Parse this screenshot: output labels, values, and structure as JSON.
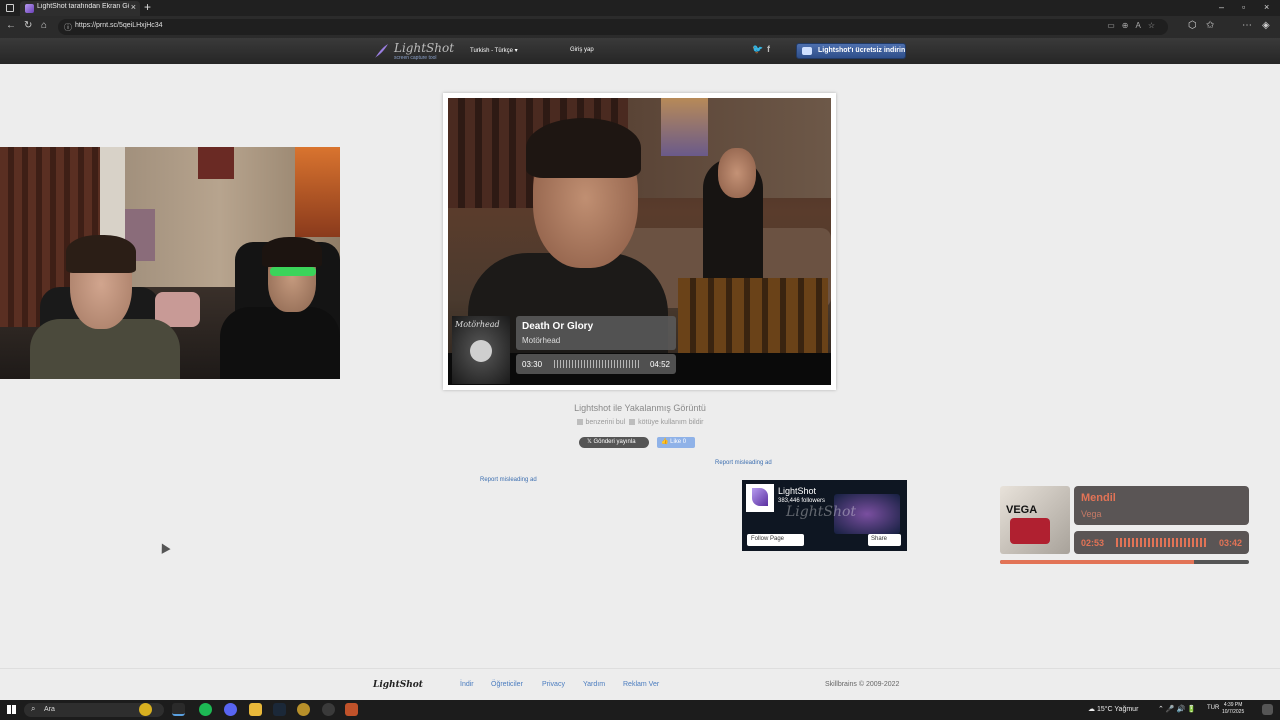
{
  "browser": {
    "tab_title": "LightShot tarafından Ekran Görün",
    "tab_close": "×",
    "new_tab": "+",
    "url": "https://prnt.sc/5qeiLHxjHc34",
    "window_controls": [
      "–",
      "▫",
      "×"
    ]
  },
  "site": {
    "logo_name": "LightShot",
    "logo_tagline": "screen capture tool",
    "language": "Turkish - Türkçe ▾",
    "login": "Giriş yap",
    "download_button": "Lightshot'ı ücretsiz indirin",
    "social": [
      "twitter-icon",
      "facebook-icon"
    ],
    "caption": "Lightshot ile Yakalanmış Görüntü",
    "similar_link": "benzerini bul",
    "report_abuse_link": "kötüye kullanım bildir",
    "tweet_button": "𝕏 Gönderi yayınla",
    "like_button": "👍 Like 0",
    "report_ad_1": "Report misleading ad",
    "report_ad_2": "Report misleading ad"
  },
  "screenshot_now_playing": {
    "album_label": "Motörhead",
    "title": "Death Or Glory",
    "artist": "Motörhead",
    "elapsed": "03:30",
    "duration": "04:52"
  },
  "fb_widget": {
    "page_name": "LightShot",
    "followers": "383,446 followers",
    "watermark": "LightShot",
    "follow_button": "Follow Page",
    "share_button": "Share"
  },
  "now_playing": {
    "album_label": "VEGA",
    "title": "Mendil",
    "artist": "Vega",
    "elapsed": "02:53",
    "duration": "03:42",
    "progress_fraction": 0.78,
    "accent": "#e27356"
  },
  "footer": {
    "logo": "LightShot",
    "links": [
      "İndir",
      "Öğreticiler",
      "Privacy",
      "Yardım",
      "Reklam Ver"
    ],
    "copyright": "Skillbrains © 2009-2022"
  },
  "taskbar": {
    "search_placeholder": "Ara",
    "weather": "15°C Yağmur",
    "language": "TUR",
    "time": "4:39 PM",
    "date": "10/7/2025"
  }
}
